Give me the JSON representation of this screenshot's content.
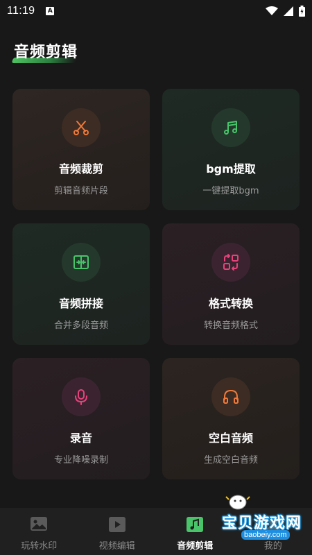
{
  "status_bar": {
    "time": "11:19",
    "notification_letter": "A"
  },
  "header": {
    "title": "音频剪辑"
  },
  "cards": [
    {
      "title": "音频裁剪",
      "subtitle": "剪辑音频片段",
      "icon": "scissors-icon",
      "color": "#f07a3a"
    },
    {
      "title": "bgm提取",
      "subtitle": "一键提取bgm",
      "icon": "music-note-icon",
      "color": "#49c46a"
    },
    {
      "title": "音频拼接",
      "subtitle": "合并多段音频",
      "icon": "merge-icon",
      "color": "#49c46a"
    },
    {
      "title": "格式转换",
      "subtitle": "转换音频格式",
      "icon": "convert-icon",
      "color": "#e8427c"
    },
    {
      "title": "录音",
      "subtitle": "专业降噪录制",
      "icon": "microphone-icon",
      "color": "#e8427c"
    },
    {
      "title": "空白音频",
      "subtitle": "生成空白音频",
      "icon": "headphones-icon",
      "color": "#f07a3a"
    }
  ],
  "tabs": [
    {
      "label": "玩转水印",
      "icon": "image-icon",
      "active": false
    },
    {
      "label": "视频编辑",
      "icon": "video-icon",
      "active": false
    },
    {
      "label": "音频剪辑",
      "icon": "audio-icon",
      "active": true
    },
    {
      "label": "我的",
      "icon": "user-icon",
      "active": false
    }
  ],
  "watermark": {
    "text": "宝贝游戏网",
    "url": "baobeiy.com"
  }
}
